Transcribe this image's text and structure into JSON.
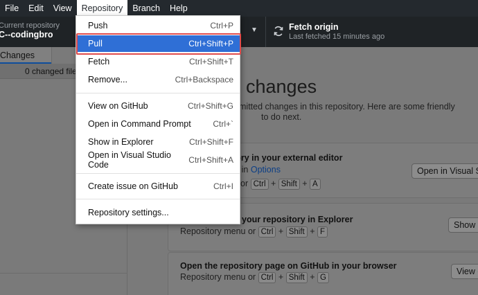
{
  "menubar": {
    "items": [
      "File",
      "Edit",
      "View",
      "Repository",
      "Branch",
      "Help"
    ],
    "active": "Repository"
  },
  "toolbar": {
    "repo_label": "Current repository",
    "repo_name": "C--codingbro",
    "fetch_title": "Fetch origin",
    "fetch_subtitle": "Last fetched 15 minutes ago"
  },
  "sidebar": {
    "tab_changes": "Changes",
    "changed_files": "0 changed files"
  },
  "main": {
    "title": "changes",
    "description_line1": "mitted changes in this repository. Here are some friendly",
    "description_line2": "to do next.",
    "cards": [
      {
        "title": "ository in your external editor",
        "sub_prefix": "r in",
        "sub_link": "Options",
        "sub2_prefix": "or",
        "keys": [
          "Ctrl",
          "Shift",
          "A"
        ],
        "button": "Open in Visual Studio Code"
      },
      {
        "title": "your repository in Explorer",
        "sub_prefix": "Repository menu or",
        "keys": [
          "Ctrl",
          "Shift",
          "F"
        ],
        "button": "Show in Explorer"
      },
      {
        "title": "Open the repository page on GitHub in your browser",
        "sub_prefix": "Repository menu or",
        "keys": [
          "Ctrl",
          "Shift",
          "G"
        ],
        "button": "View on GitHub"
      }
    ]
  },
  "dropdown": {
    "items": [
      {
        "label": "Push",
        "shortcut": "Ctrl+P"
      },
      {
        "label": "Pull",
        "shortcut": "Ctrl+Shift+P",
        "selected": true
      },
      {
        "label": "Fetch",
        "shortcut": "Ctrl+Shift+T"
      },
      {
        "label": "Remove...",
        "shortcut": "Ctrl+Backspace"
      },
      {
        "label": "View on GitHub",
        "shortcut": "Ctrl+Shift+G"
      },
      {
        "label": "Open in Command Prompt",
        "shortcut": "Ctrl+`"
      },
      {
        "label": "Show in Explorer",
        "shortcut": "Ctrl+Shift+F"
      },
      {
        "label": "Open in Visual Studio Code",
        "shortcut": "Ctrl+Shift+A"
      },
      {
        "label": "Create issue on GitHub",
        "shortcut": "Ctrl+I"
      },
      {
        "label": "Repository settings...",
        "shortcut": ""
      }
    ]
  },
  "colors": {
    "menubar_bg": "#24292e",
    "selected_item_bg": "#2f6fd6",
    "annotation_red": "#e04b4b",
    "overlay_gray": "#7a7a7a"
  },
  "icons": {
    "fetch": "sync-icon",
    "branch_caret": "caret-down-icon"
  }
}
